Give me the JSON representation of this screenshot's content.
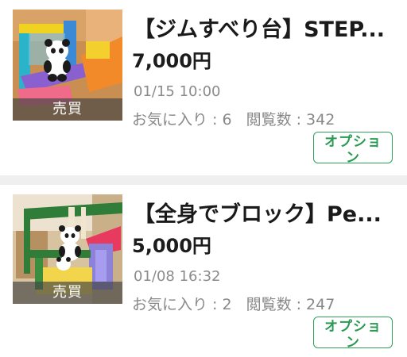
{
  "listings": [
    {
      "title": "【ジムすべり台】STEP...",
      "price": "7,000円",
      "datetime": "01/15 10:00",
      "favorites_label": "お気に入り : 6",
      "views_label": "閲覧数 : 342",
      "badge": "売買",
      "option_label": "オプション",
      "thumbnail_icon": "slide-toy-photo"
    },
    {
      "title": "【全身でブロック】Pe...",
      "price": "5,000円",
      "datetime": "01/08 16:32",
      "favorites_label": "お気に入り : 2",
      "views_label": "閲覧数 : 247",
      "badge": "売買",
      "option_label": "オプション",
      "thumbnail_icon": "play-house-toy-photo"
    }
  ],
  "colors": {
    "option_green": "#2ea05a",
    "meta_gray": "#8b8b8b",
    "title_black": "#1a1a1a"
  }
}
